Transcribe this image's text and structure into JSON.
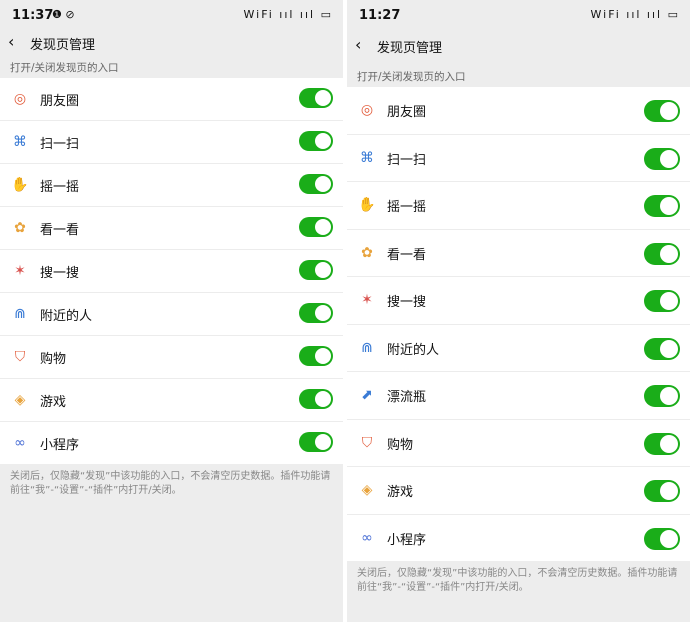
{
  "left": {
    "status": {
      "time": "11:37",
      "icons_left": "❶ ⊘",
      "icons_right": "WiFi ııl ııl ▭"
    },
    "nav": {
      "back_icon": "‹",
      "title": "发现页管理"
    },
    "section_header": "打开/关闭发现页的入口",
    "items": [
      {
        "label": "朋友圈",
        "icon": "moments-icon",
        "glyph": "◎",
        "color": "#e25c3b",
        "enabled": true
      },
      {
        "label": "扫一扫",
        "icon": "scan-icon",
        "glyph": "⌘",
        "color": "#3a7bd5",
        "enabled": true
      },
      {
        "label": "摇一摇",
        "icon": "shake-icon",
        "glyph": "✋",
        "color": "#3a7bd5",
        "enabled": true
      },
      {
        "label": "看一看",
        "icon": "top-stories-icon",
        "glyph": "✿",
        "color": "#e8a33c",
        "enabled": true
      },
      {
        "label": "搜一搜",
        "icon": "search-icon",
        "glyph": "✶",
        "color": "#d9534f",
        "enabled": true
      },
      {
        "label": "附近的人",
        "icon": "people-nearby-icon",
        "glyph": "⋒",
        "color": "#3a7bd5",
        "enabled": true
      },
      {
        "label": "购物",
        "icon": "shopping-bag-icon",
        "glyph": "⛉",
        "color": "#e25c3b",
        "enabled": true
      },
      {
        "label": "游戏",
        "icon": "games-icon",
        "glyph": "◈",
        "color": "#e8a33c",
        "enabled": true
      },
      {
        "label": "小程序",
        "icon": "mini-program-icon",
        "glyph": "∞",
        "color": "#4a6fd5",
        "enabled": true
      }
    ],
    "footer_note": "关闭后，仅隐藏“发现”中该功能的入口，不会清空历史数据。插件功能请前往“我”-“设置”-“插件”内打开/关闭。"
  },
  "right": {
    "status": {
      "time": "11:27",
      "icons_right": "WiFi ııl ııl ▭"
    },
    "nav": {
      "back_icon": "‹",
      "title": "发现页管理"
    },
    "section_header": "打开/关闭发现页的入口",
    "items": [
      {
        "label": "朋友圈",
        "icon": "moments-icon",
        "glyph": "◎",
        "color": "#e25c3b",
        "enabled": true
      },
      {
        "label": "扫一扫",
        "icon": "scan-icon",
        "glyph": "⌘",
        "color": "#3a7bd5",
        "enabled": true
      },
      {
        "label": "摇一摇",
        "icon": "shake-icon",
        "glyph": "✋",
        "color": "#3a7bd5",
        "enabled": true
      },
      {
        "label": "看一看",
        "icon": "top-stories-icon",
        "glyph": "✿",
        "color": "#e8a33c",
        "enabled": true
      },
      {
        "label": "搜一搜",
        "icon": "search-icon",
        "glyph": "✶",
        "color": "#d9534f",
        "enabled": true
      },
      {
        "label": "附近的人",
        "icon": "people-nearby-icon",
        "glyph": "⋒",
        "color": "#3a7bd5",
        "enabled": true
      },
      {
        "label": "漂流瓶",
        "icon": "drift-bottle-icon",
        "glyph": "⬈",
        "color": "#3a7bd5",
        "enabled": true
      },
      {
        "label": "购物",
        "icon": "shopping-bag-icon",
        "glyph": "⛉",
        "color": "#e25c3b",
        "enabled": true
      },
      {
        "label": "游戏",
        "icon": "games-icon",
        "glyph": "◈",
        "color": "#e8a33c",
        "enabled": true
      },
      {
        "label": "小程序",
        "icon": "mini-program-icon",
        "glyph": "∞",
        "color": "#4a6fd5",
        "enabled": true
      }
    ],
    "footer_note": "关闭后，仅隐藏“发现”中该功能的入口，不会清空历史数据。插件功能请前往“我”-“设置”-“插件”内打开/关闭。"
  },
  "colors": {
    "toggle_on": "#1aad19",
    "background": "#ededed"
  }
}
